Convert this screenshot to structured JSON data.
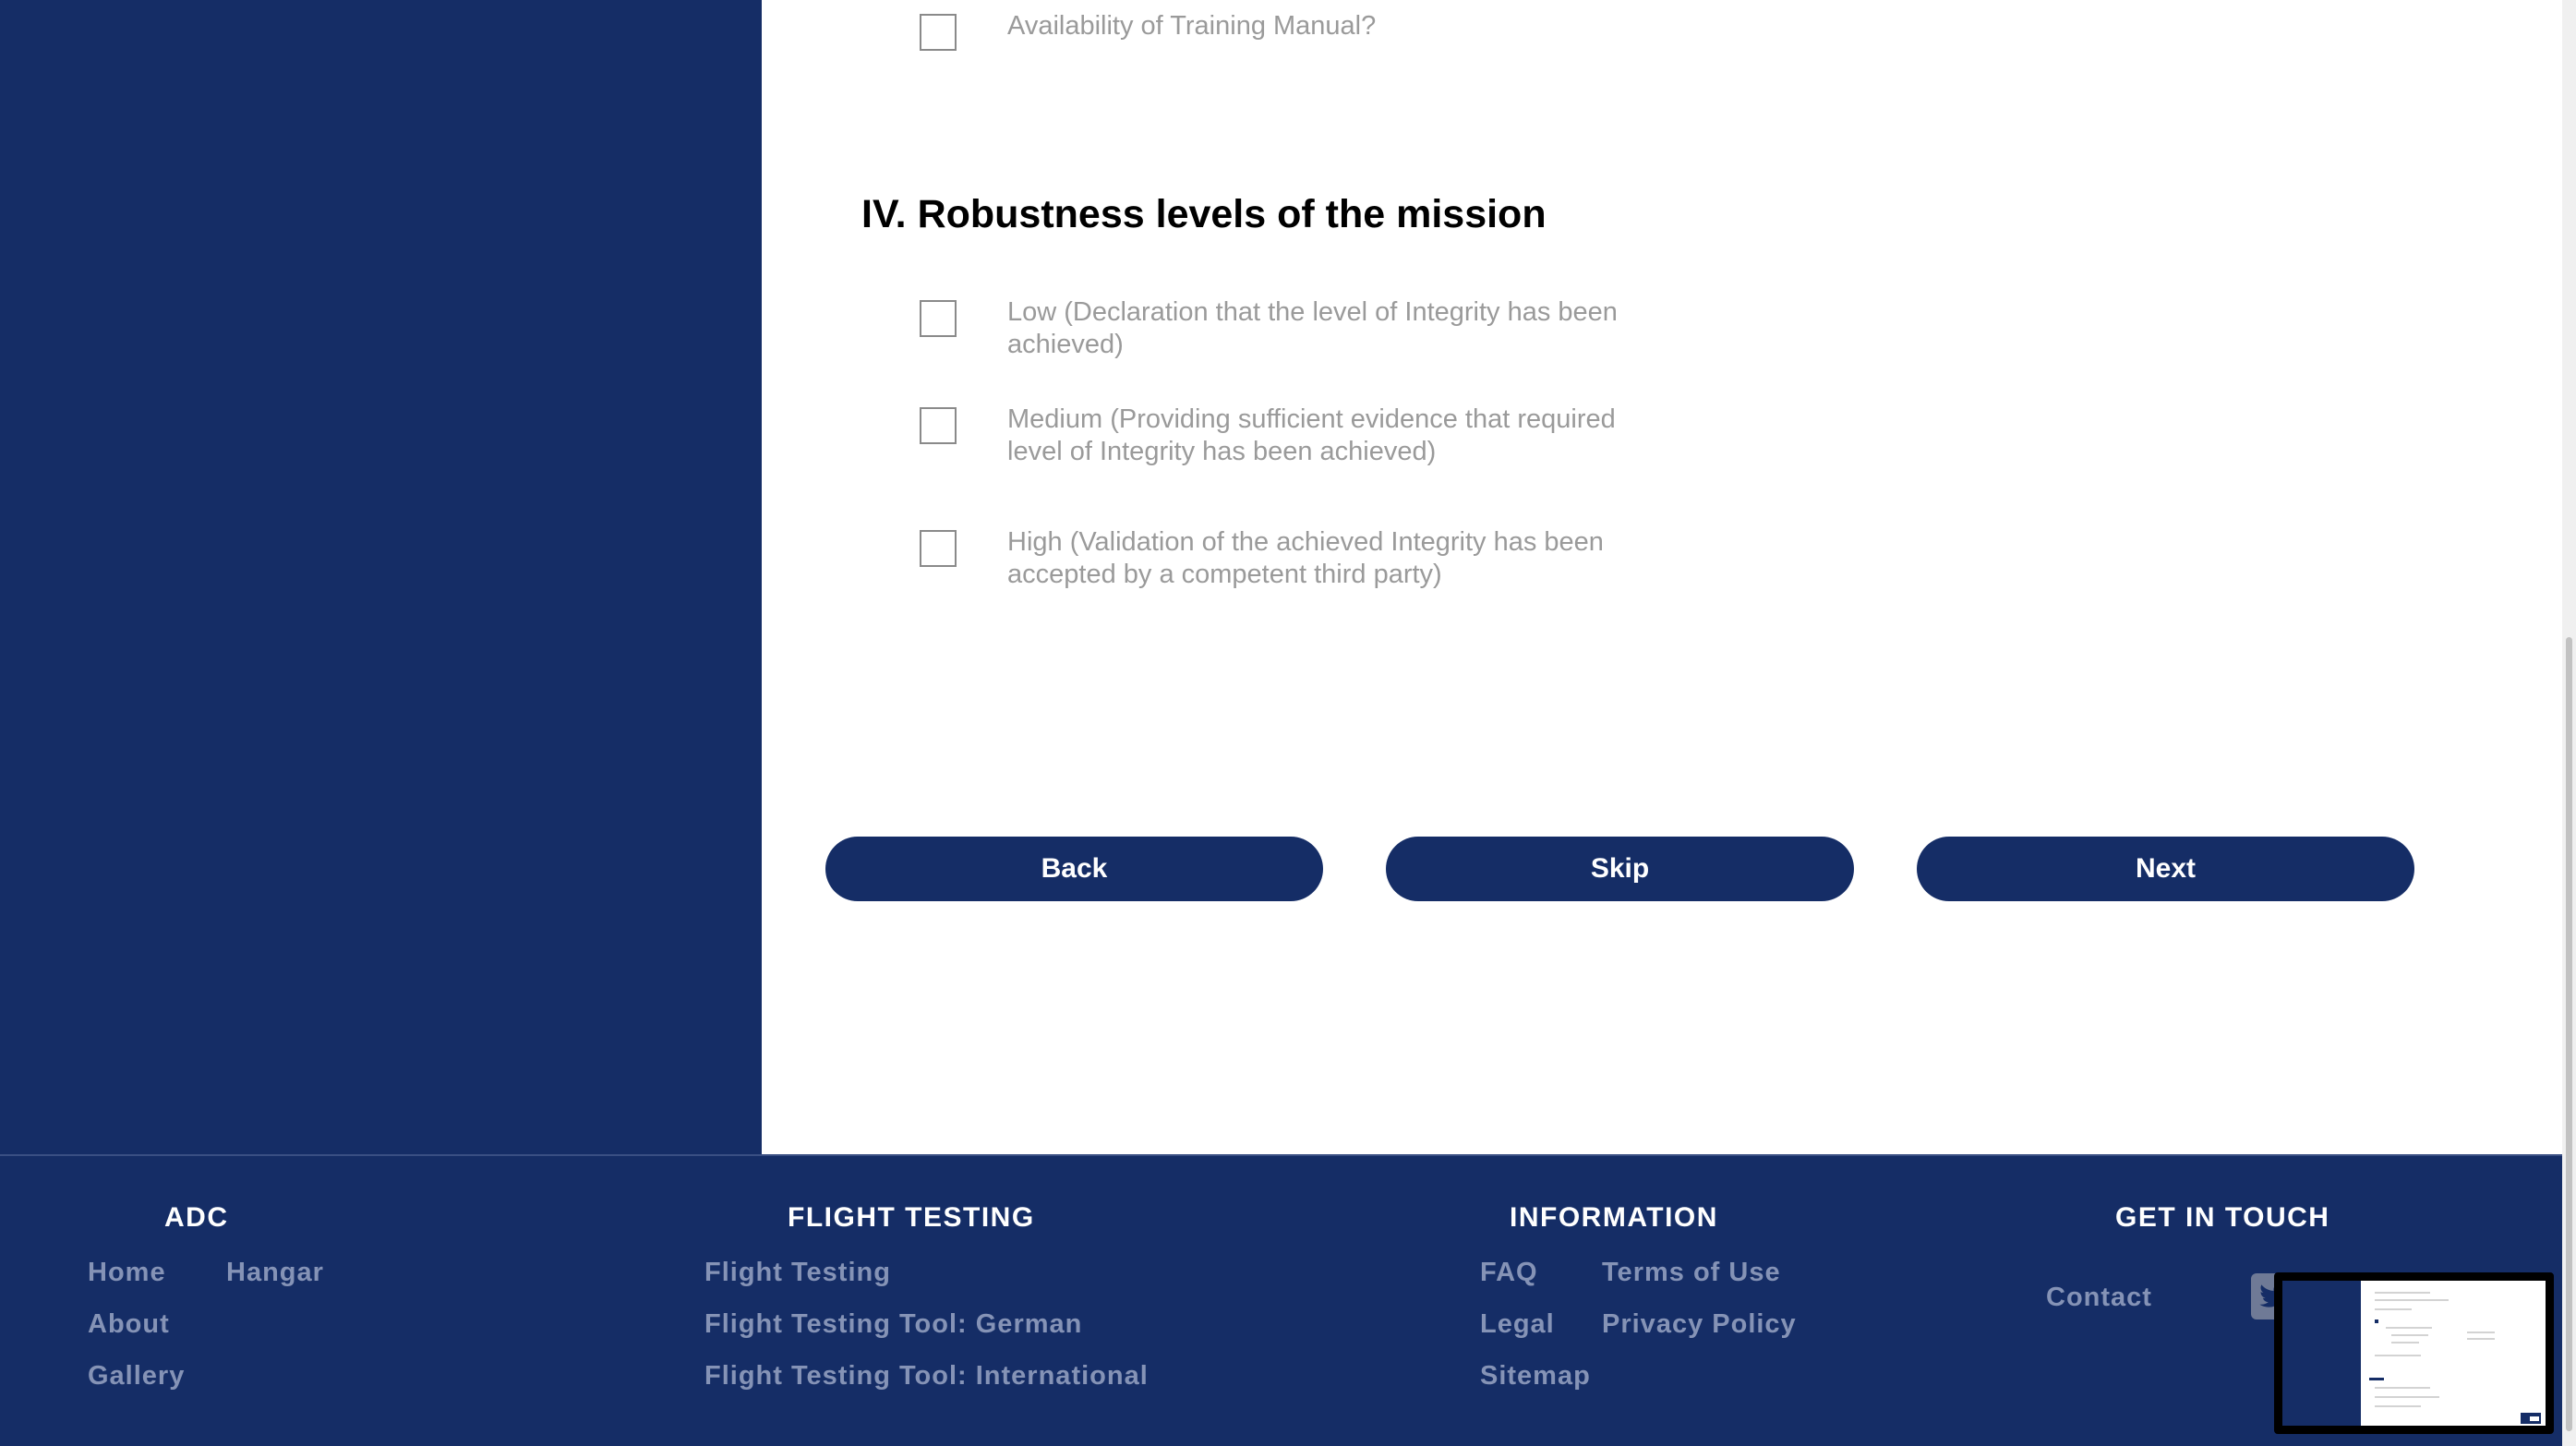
{
  "prev_question": {
    "label": "Availability of Training Manual?"
  },
  "section": {
    "title": "IV. Robustness levels of the mission",
    "options": [
      {
        "label": "Low (Declaration that the level of Integrity has been achieved)"
      },
      {
        "label": "Medium (Providing sufficient evidence that required level of Integrity has been achieved)"
      },
      {
        "label": "High (Validation of the achieved Integrity has been accepted by a competent third party)"
      }
    ]
  },
  "nav": {
    "back": "Back",
    "skip": "Skip",
    "next": "Next"
  },
  "colors": {
    "brand_navy": "#152d66",
    "muted_link": "#8593b6",
    "option_text": "#9a9a9a"
  },
  "footer": {
    "adc": {
      "title": "ADC",
      "links": [
        "Home",
        "Hangar",
        "About",
        "Gallery"
      ]
    },
    "flight_testing": {
      "title": "FLIGHT TESTING",
      "links": [
        "Flight Testing",
        "Flight Testing Tool: German",
        "Flight Testing Tool: International"
      ]
    },
    "information": {
      "title": "INFORMATION",
      "links": [
        "FAQ",
        "Terms of Use",
        "Legal",
        "Privacy Policy",
        "Sitemap"
      ]
    },
    "get_in_touch": {
      "title": "GET IN TOUCH",
      "contact": "Contact",
      "social_icon": "twitter-icon"
    }
  }
}
